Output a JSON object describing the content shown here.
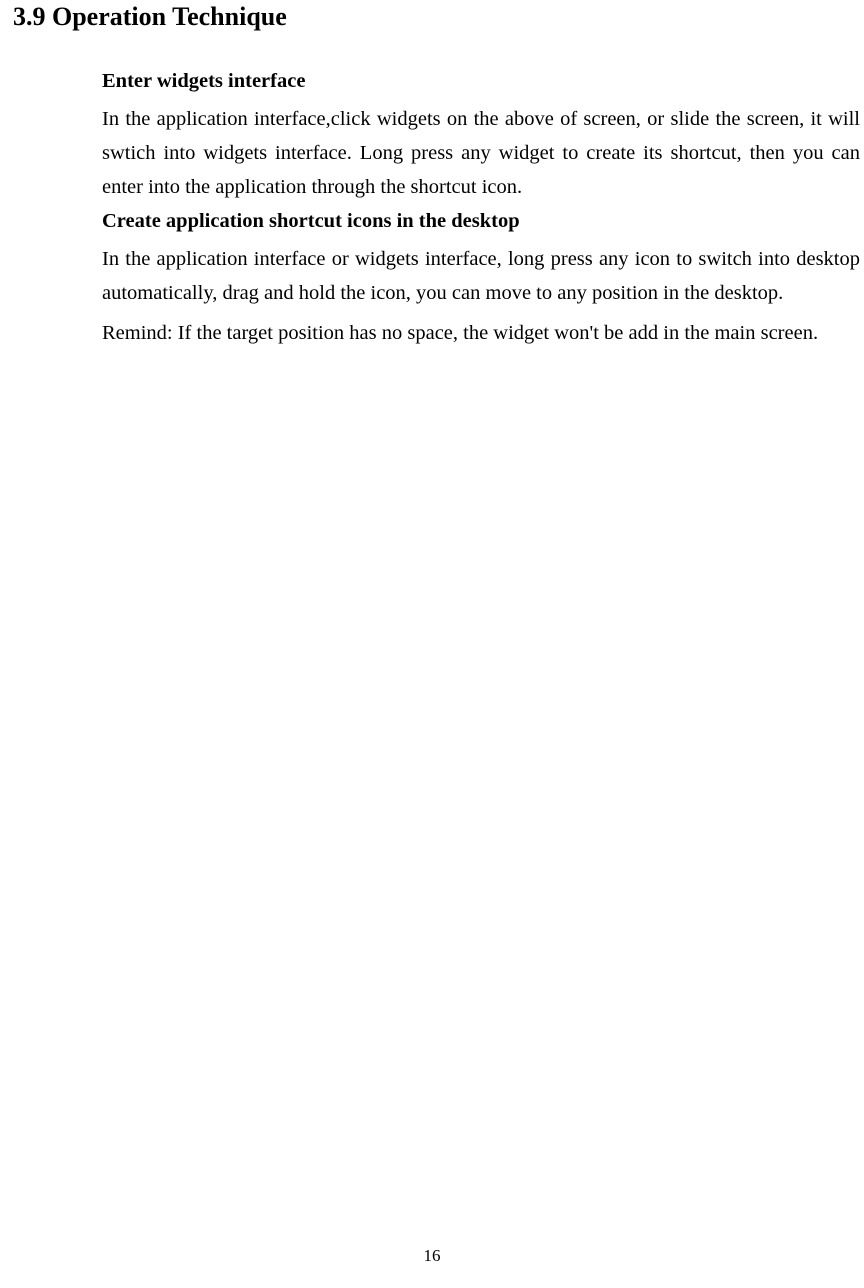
{
  "heading": "3.9 Operation Technique",
  "section1": {
    "title": "Enter widgets interface",
    "body": "In the application interface,click widgets on the above of screen, or slide the screen, it will swtich into widgets interface. Long press any widget to create its shortcut, then you can enter into the application through the shortcut icon."
  },
  "section2": {
    "title": "Create application shortcut icons in the desktop",
    "body1": "In the application interface or widgets interface, long press any icon to switch into desktop automatically, drag and hold the icon, you can move to any position in the desktop.",
    "body2": "Remind: If the target position has no space, the widget won't be add in the main screen."
  },
  "pageNumber": "16"
}
